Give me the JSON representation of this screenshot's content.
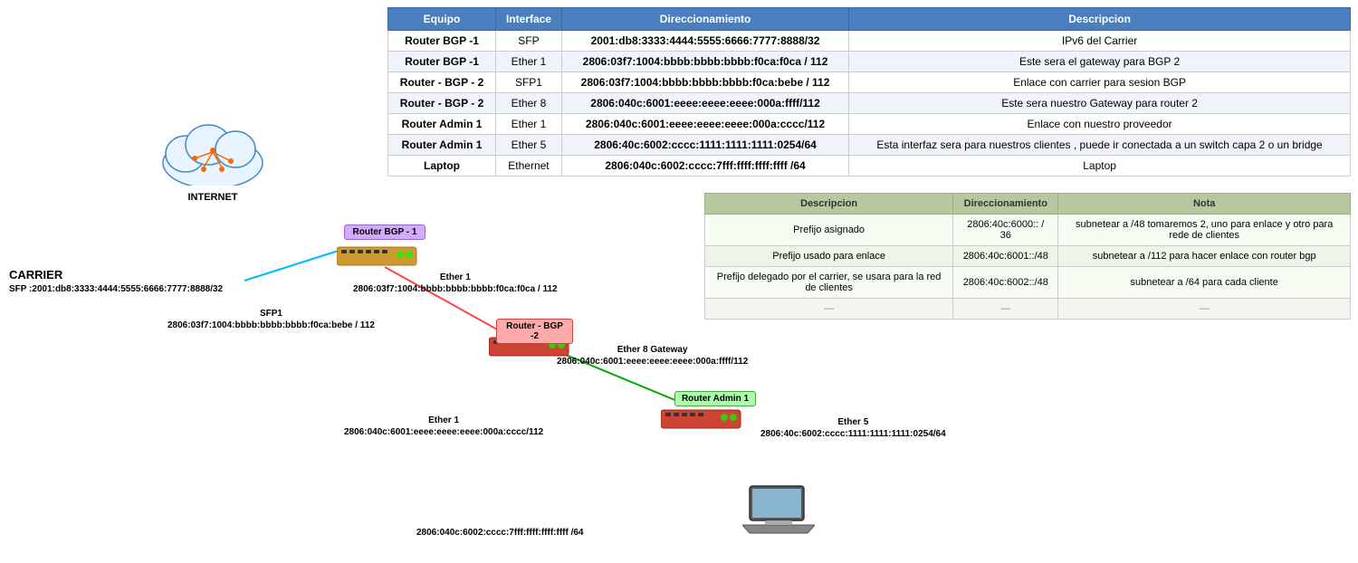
{
  "table": {
    "headers": [
      "Equipo",
      "Interface",
      "Direccionamiento",
      "Descripcion"
    ],
    "rows": [
      [
        "Router BGP -1",
        "SFP",
        "2001:db8:3333:4444:5555:6666:7777:8888/32",
        "IPv6 del Carrier"
      ],
      [
        "Router BGP -1",
        "Ether 1",
        "2806:03f7:1004:bbbb:bbbb:bbbb:f0ca:f0ca / 112",
        "Este sera el gateway para BGP 2"
      ],
      [
        "Router - BGP - 2",
        "SFP1",
        "2806:03f7:1004:bbbb:bbbb:bbbb:f0ca:bebe / 112",
        "Enlace con carrier para sesion BGP"
      ],
      [
        "Router - BGP - 2",
        "Ether 8",
        "2806:040c:6001:eeee:eeee:eeee:000a:ffff/112",
        "Este sera nuestro Gateway para router 2"
      ],
      [
        "Router Admin 1",
        "Ether 1",
        "2806:040c:6001:eeee:eeee:eeee:000a:cccc/112",
        "Enlace con nuestro proveedor"
      ],
      [
        "Router Admin 1",
        "Ether 5",
        "2806:40c:6002:cccc:1111:1111:1111:0254/64",
        "Esta interfaz sera para nuestros clientes , puede ir conectada a un switch capa 2 o un bridge"
      ],
      [
        "Laptop",
        "Ethernet",
        "2806:040c:6002:cccc:7fff:ffff:ffff:ffff /64",
        "Laptop"
      ]
    ]
  },
  "lower_table": {
    "headers": [
      "Descripcion",
      "Direccionamiento",
      "Nota"
    ],
    "rows": [
      [
        "Prefijo asignado",
        "2806:40c:6000:: / 36",
        "subnetear a /48  tomaremos 2, uno para enlace y otro para rede de clientes"
      ],
      [
        "Prefijo usado para enlace",
        "2806:40c:6001::/48",
        "subnetear a /112 para hacer enlace con router bgp"
      ],
      [
        "Prefijo delegado por el carrier, se usara para la red de clientes",
        "2806:40c:6002::/48",
        "subnetear a /64 para cada cliente"
      ],
      [
        "—",
        "—",
        "—"
      ]
    ]
  },
  "diagram": {
    "internet_label": "INTERNET",
    "carrier_label": "CARRIER",
    "carrier_sfp": "SFP :2001:db8:3333:4444:5555:6666:7777:8888/32",
    "router_bgp1_label": "Router BGP -\n1",
    "router_bgp1_ether1": "Ether 1",
    "router_bgp1_ether1_addr": "2806:03f7:1004:bbbb:bbbb:bbbb:f0ca:f0ca / 112",
    "router_bgp2_label": "Router - BGP -2",
    "router_bgp2_sfp1": "SFP1",
    "router_bgp2_sfp1_addr": "2806:03f7:1004:bbbb:bbbb:bbbb:f0ca:bebe / 112",
    "router_bgp2_ether8": "Ether 8 Gateway",
    "router_bgp2_ether8_addr": "2806:040c:6001:eeee:eeee:eeee:000a:ffff/112",
    "router_admin1_label": "Router Admin 1",
    "router_admin1_ether1": "Ether 1",
    "router_admin1_ether1_addr": "2806:040c:6001:eeee:eeee:eeee:000a:cccc/112",
    "router_admin1_ether5": "Ether 5",
    "router_admin1_ether5_addr": "2806:40c:6002:cccc:1111:1111:1111:0254/64",
    "laptop_addr": "2806:040c:6002:cccc:7fff:ffff:ffff:ffff /64"
  }
}
